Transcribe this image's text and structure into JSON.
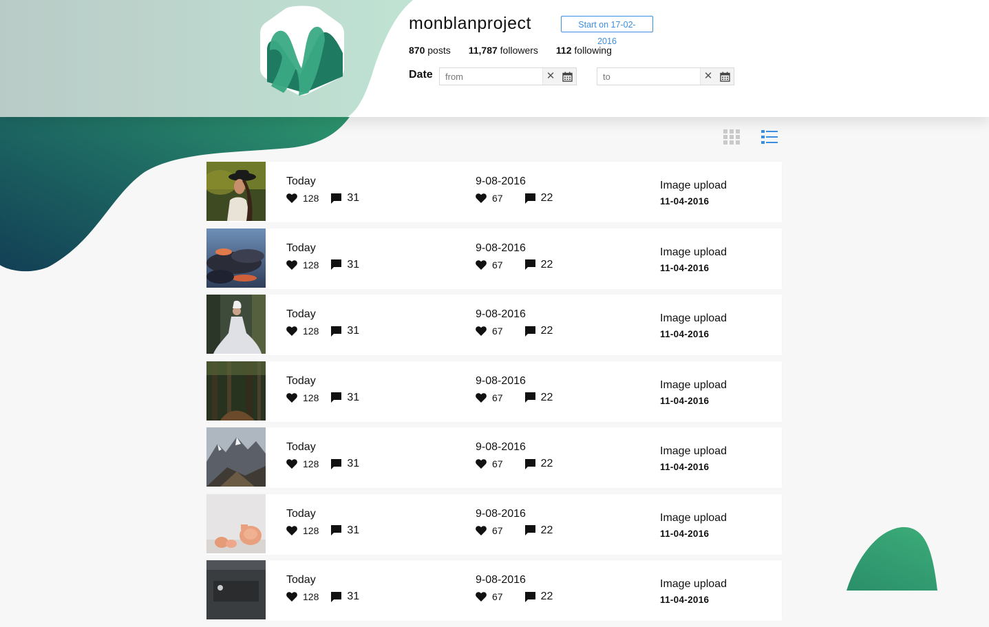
{
  "profile": {
    "username": "monblanproject",
    "start_badge": "Start on 17-02-2016",
    "posts_count": "870",
    "posts_label": "posts",
    "followers_count": "11,787",
    "followers_label": "followers",
    "following_count": "112",
    "following_label": "following"
  },
  "filter": {
    "date_label": "Date",
    "from_placeholder": "from",
    "to_placeholder": "to",
    "clear_glyph": "✕"
  },
  "view": {
    "grid_icon": "grid-icon",
    "list_icon": "list-icon",
    "active": "list"
  },
  "colors": {
    "accent": "#3a8ee0",
    "green_light": "#b9dfd0",
    "green_dark": "#1f7a62",
    "teal_deep": "#123f55"
  },
  "posts": [
    {
      "thumb": "woman-hat",
      "c1_title": "Today",
      "c1_likes": "128",
      "c1_comments": "31",
      "c2_title": "9-08-2016",
      "c2_likes": "67",
      "c2_comments": "22",
      "c3_title": "Image upload",
      "c3_date": "11-04-2016"
    },
    {
      "thumb": "cloudy-sky",
      "c1_title": "Today",
      "c1_likes": "128",
      "c1_comments": "31",
      "c2_title": "9-08-2016",
      "c2_likes": "67",
      "c2_comments": "22",
      "c3_title": "Image upload",
      "c3_date": "11-04-2016"
    },
    {
      "thumb": "bride-forest",
      "c1_title": "Today",
      "c1_likes": "128",
      "c1_comments": "31",
      "c2_title": "9-08-2016",
      "c2_likes": "67",
      "c2_comments": "22",
      "c3_title": "Image upload",
      "c3_date": "11-04-2016"
    },
    {
      "thumb": "forest-path",
      "c1_title": "Today",
      "c1_likes": "128",
      "c1_comments": "31",
      "c2_title": "9-08-2016",
      "c2_likes": "67",
      "c2_comments": "22",
      "c3_title": "Image upload",
      "c3_date": "11-04-2016"
    },
    {
      "thumb": "mountains",
      "c1_title": "Today",
      "c1_likes": "128",
      "c1_comments": "31",
      "c2_title": "9-08-2016",
      "c2_likes": "67",
      "c2_comments": "22",
      "c3_title": "Image upload",
      "c3_date": "11-04-2016"
    },
    {
      "thumb": "ceramic-vases",
      "c1_title": "Today",
      "c1_likes": "128",
      "c1_comments": "31",
      "c2_title": "9-08-2016",
      "c2_likes": "67",
      "c2_comments": "22",
      "c3_title": "Image upload",
      "c3_date": "11-04-2016"
    },
    {
      "thumb": "dark-interior",
      "c1_title": "Today",
      "c1_likes": "128",
      "c1_comments": "31",
      "c2_title": "9-08-2016",
      "c2_likes": "67",
      "c2_comments": "22",
      "c3_title": "Image upload",
      "c3_date": "11-04-2016"
    }
  ]
}
